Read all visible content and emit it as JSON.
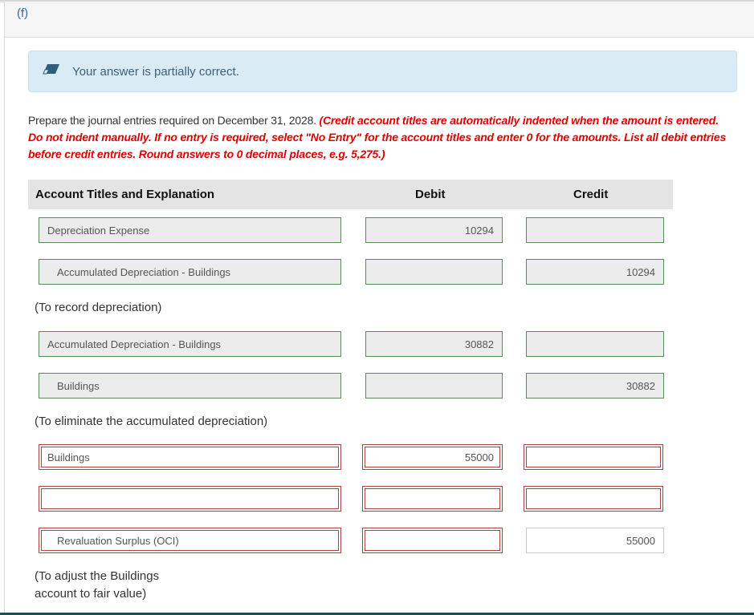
{
  "part": {
    "label": "(f)"
  },
  "feedback": {
    "icon": "eraser-icon",
    "text": "Your answer is partially correct."
  },
  "instructions": {
    "lead": "Prepare the journal entries required on December 31, 2028. ",
    "note": "(Credit account titles are automatically indented when the amount is entered. Do not indent manually. If no entry is required, select \"No Entry\" for the account titles and enter 0 for the amounts. List all debit entries before credit entries. Round answers to 0 decimal places, e.g. 5,275.)"
  },
  "table": {
    "headers": {
      "account": "Account Titles and Explanation",
      "debit": "Debit",
      "credit": "Credit"
    },
    "entries": [
      {
        "rows": [
          {
            "account": "Depreciation Expense",
            "debit": "10294",
            "credit": "",
            "status": "correct"
          },
          {
            "account": "Accumulated Depreciation - Buildings",
            "debit": "",
            "credit": "10294",
            "status": "correct"
          }
        ],
        "memo": "(To record depreciation)"
      },
      {
        "rows": [
          {
            "account": "Accumulated Depreciation - Buildings",
            "debit": "30882",
            "credit": "",
            "status": "correct"
          },
          {
            "account": "Buildings",
            "debit": "",
            "credit": "30882",
            "status": "correct"
          }
        ],
        "memo": "(To eliminate the accumulated depreciation)"
      },
      {
        "rows": [
          {
            "account": "Buildings",
            "debit": "55000",
            "credit": "",
            "status": "incorrect"
          },
          {
            "account": "",
            "debit": "",
            "credit": "",
            "status": "incorrect"
          },
          {
            "account": "Revaluation Surplus (OCI)",
            "debit": "",
            "credit": "55000",
            "status": "incorrect"
          }
        ],
        "memo_line1": "(To adjust the Buildings",
        "memo_line2": "account to fair value)"
      }
    ]
  },
  "colors": {
    "correct_border": "#5a8a5a",
    "incorrect_border": "#a94442",
    "feedback_bg": "#d9ecf6",
    "instruction_red": "#e00000"
  }
}
